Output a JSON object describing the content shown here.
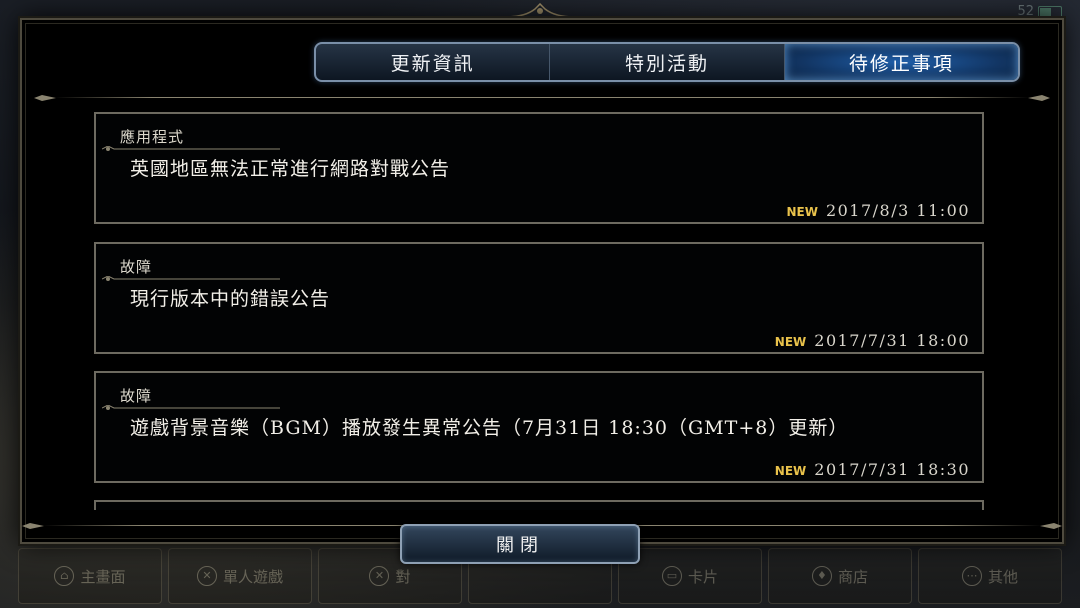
{
  "status": {
    "battery": "52"
  },
  "tabs": [
    {
      "label": "更新資訊"
    },
    {
      "label": "特別活動"
    },
    {
      "label": "待修正事項"
    }
  ],
  "active_tab_index": 2,
  "notices": [
    {
      "category": "應用程式",
      "title": "英國地區無法正常進行網路對戰公告",
      "badge": "NEW",
      "date": "2017/8/3  11:00"
    },
    {
      "category": "故障",
      "title": "現行版本中的錯誤公告",
      "badge": "NEW",
      "date": "2017/7/31  18:00"
    },
    {
      "category": "故障",
      "title": "遊戲背景音樂（BGM）播放發生異常公告（7月31日 18:30（GMT+8）更新）",
      "badge": "NEW",
      "date": "2017/7/31  18:30"
    }
  ],
  "close_button": {
    "label": "關閉"
  },
  "bottom_nav": [
    {
      "label": "主畫面"
    },
    {
      "label": "單人遊戲"
    },
    {
      "label": "對"
    },
    {
      "label": ""
    },
    {
      "label": "卡片"
    },
    {
      "label": "商店"
    },
    {
      "label": "其他"
    }
  ],
  "colors": {
    "accent_blue": "#1f5ea8",
    "badge_new": "#e9c24b",
    "frame_gold": "#8a8470"
  }
}
